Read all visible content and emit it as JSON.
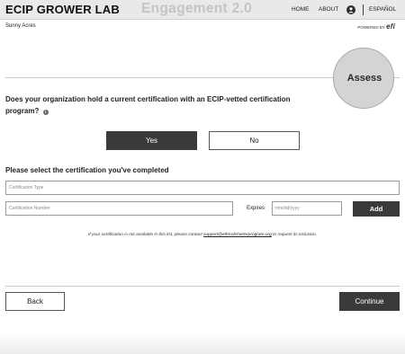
{
  "header": {
    "brand": "ECIP GROWER LAB",
    "page_heading": "Engagement 2.0",
    "nav": {
      "home": "HOME",
      "about": "ABOUT",
      "language": "ESPAÑOL"
    }
  },
  "org": {
    "name": "Sunny Acres",
    "powered_by": "POWERED BY",
    "powered_brand": "efi"
  },
  "step": {
    "label": "Assess"
  },
  "question": {
    "text": "Does your organization hold a current certification with an ECIP-vetted certification program?",
    "info_glyph": "i",
    "yes_label": "Yes",
    "no_label": "No"
  },
  "certification": {
    "title": "Please select the certification you've completed",
    "type_placeholder": "Certification Type",
    "number_placeholder": "Certification Number",
    "expires_label": "Expires",
    "date_placeholder": "mm/dd/yyyy",
    "add_label": "Add"
  },
  "help": {
    "prefix": "If your certification is not available in this list, please contact ",
    "email": "support@ethicalcharterprogram.org",
    "suffix": " to request its inclusion."
  },
  "footer": {
    "back_label": "Back",
    "continue_label": "Continue"
  },
  "colors": {
    "primary_button": "#3a3a3a",
    "header_bg": "#e9e9e9",
    "step_badge": "#d4d4d4"
  }
}
